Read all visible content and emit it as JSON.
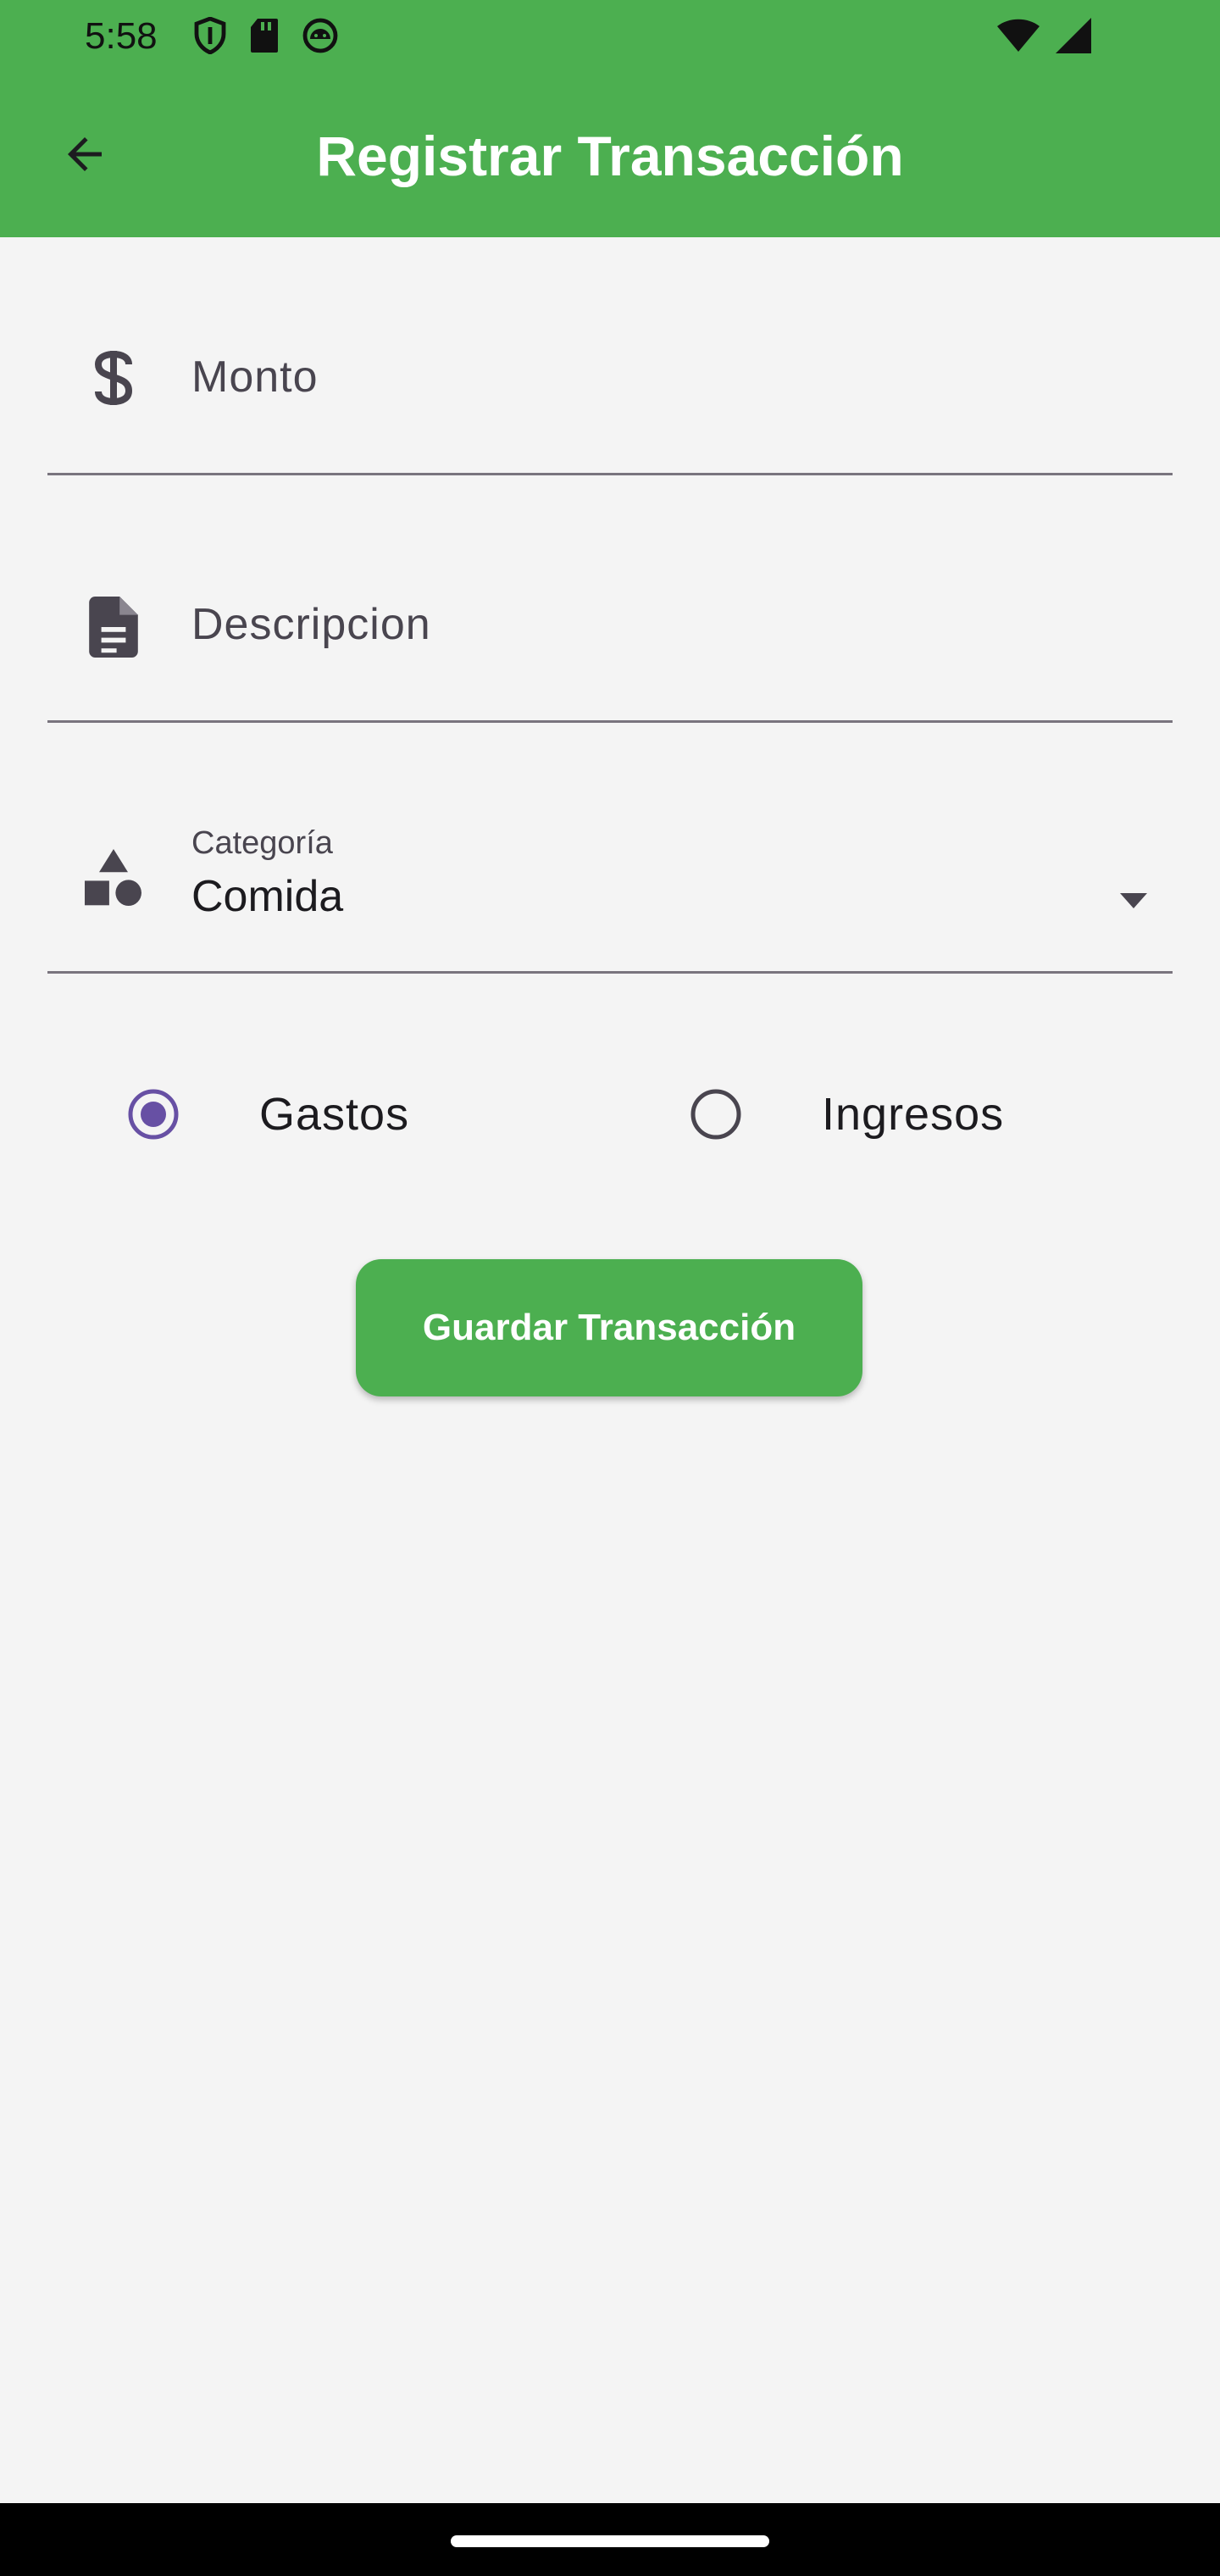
{
  "status_bar": {
    "time": "5:58",
    "left_icons": [
      "shield-icon",
      "sd-card-icon",
      "android-icon"
    ],
    "right_icons": [
      "wifi-icon",
      "signal-icon"
    ]
  },
  "app_bar": {
    "title": "Registrar Transacción",
    "back_icon": "arrow-back-icon",
    "color": "#4caf50"
  },
  "form": {
    "amount": {
      "icon": "dollar-icon",
      "placeholder": "Monto",
      "value": ""
    },
    "description": {
      "icon": "document-icon",
      "placeholder": "Descripcion",
      "value": ""
    },
    "category": {
      "icon": "category-icon",
      "label": "Categoría",
      "selected": "Comida"
    },
    "type": {
      "options": [
        {
          "label": "Gastos",
          "selected": true
        },
        {
          "label": "Ingresos",
          "selected": false
        }
      ],
      "selected_color": "#6750a4"
    },
    "save_label": "Guardar Transacción"
  }
}
